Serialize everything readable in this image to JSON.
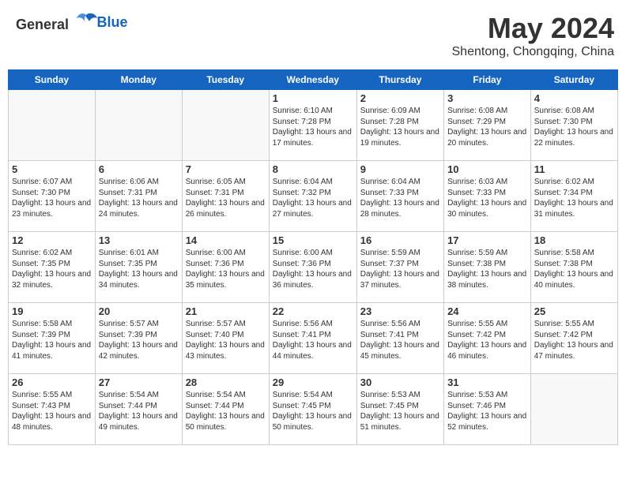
{
  "header": {
    "logo_general": "General",
    "logo_blue": "Blue",
    "month": "May 2024",
    "location": "Shentong, Chongqing, China"
  },
  "weekdays": [
    "Sunday",
    "Monday",
    "Tuesday",
    "Wednesday",
    "Thursday",
    "Friday",
    "Saturday"
  ],
  "weeks": [
    [
      {
        "day": "",
        "empty": true
      },
      {
        "day": "",
        "empty": true
      },
      {
        "day": "",
        "empty": true
      },
      {
        "day": "1",
        "sunrise": "Sunrise: 6:10 AM",
        "sunset": "Sunset: 7:28 PM",
        "daylight": "Daylight: 13 hours and 17 minutes."
      },
      {
        "day": "2",
        "sunrise": "Sunrise: 6:09 AM",
        "sunset": "Sunset: 7:28 PM",
        "daylight": "Daylight: 13 hours and 19 minutes."
      },
      {
        "day": "3",
        "sunrise": "Sunrise: 6:08 AM",
        "sunset": "Sunset: 7:29 PM",
        "daylight": "Daylight: 13 hours and 20 minutes."
      },
      {
        "day": "4",
        "sunrise": "Sunrise: 6:08 AM",
        "sunset": "Sunset: 7:30 PM",
        "daylight": "Daylight: 13 hours and 22 minutes."
      }
    ],
    [
      {
        "day": "5",
        "sunrise": "Sunrise: 6:07 AM",
        "sunset": "Sunset: 7:30 PM",
        "daylight": "Daylight: 13 hours and 23 minutes."
      },
      {
        "day": "6",
        "sunrise": "Sunrise: 6:06 AM",
        "sunset": "Sunset: 7:31 PM",
        "daylight": "Daylight: 13 hours and 24 minutes."
      },
      {
        "day": "7",
        "sunrise": "Sunrise: 6:05 AM",
        "sunset": "Sunset: 7:31 PM",
        "daylight": "Daylight: 13 hours and 26 minutes."
      },
      {
        "day": "8",
        "sunrise": "Sunrise: 6:04 AM",
        "sunset": "Sunset: 7:32 PM",
        "daylight": "Daylight: 13 hours and 27 minutes."
      },
      {
        "day": "9",
        "sunrise": "Sunrise: 6:04 AM",
        "sunset": "Sunset: 7:33 PM",
        "daylight": "Daylight: 13 hours and 28 minutes."
      },
      {
        "day": "10",
        "sunrise": "Sunrise: 6:03 AM",
        "sunset": "Sunset: 7:33 PM",
        "daylight": "Daylight: 13 hours and 30 minutes."
      },
      {
        "day": "11",
        "sunrise": "Sunrise: 6:02 AM",
        "sunset": "Sunset: 7:34 PM",
        "daylight": "Daylight: 13 hours and 31 minutes."
      }
    ],
    [
      {
        "day": "12",
        "sunrise": "Sunrise: 6:02 AM",
        "sunset": "Sunset: 7:35 PM",
        "daylight": "Daylight: 13 hours and 32 minutes."
      },
      {
        "day": "13",
        "sunrise": "Sunrise: 6:01 AM",
        "sunset": "Sunset: 7:35 PM",
        "daylight": "Daylight: 13 hours and 34 minutes."
      },
      {
        "day": "14",
        "sunrise": "Sunrise: 6:00 AM",
        "sunset": "Sunset: 7:36 PM",
        "daylight": "Daylight: 13 hours and 35 minutes."
      },
      {
        "day": "15",
        "sunrise": "Sunrise: 6:00 AM",
        "sunset": "Sunset: 7:36 PM",
        "daylight": "Daylight: 13 hours and 36 minutes."
      },
      {
        "day": "16",
        "sunrise": "Sunrise: 5:59 AM",
        "sunset": "Sunset: 7:37 PM",
        "daylight": "Daylight: 13 hours and 37 minutes."
      },
      {
        "day": "17",
        "sunrise": "Sunrise: 5:59 AM",
        "sunset": "Sunset: 7:38 PM",
        "daylight": "Daylight: 13 hours and 38 minutes."
      },
      {
        "day": "18",
        "sunrise": "Sunrise: 5:58 AM",
        "sunset": "Sunset: 7:38 PM",
        "daylight": "Daylight: 13 hours and 40 minutes."
      }
    ],
    [
      {
        "day": "19",
        "sunrise": "Sunrise: 5:58 AM",
        "sunset": "Sunset: 7:39 PM",
        "daylight": "Daylight: 13 hours and 41 minutes."
      },
      {
        "day": "20",
        "sunrise": "Sunrise: 5:57 AM",
        "sunset": "Sunset: 7:39 PM",
        "daylight": "Daylight: 13 hours and 42 minutes."
      },
      {
        "day": "21",
        "sunrise": "Sunrise: 5:57 AM",
        "sunset": "Sunset: 7:40 PM",
        "daylight": "Daylight: 13 hours and 43 minutes."
      },
      {
        "day": "22",
        "sunrise": "Sunrise: 5:56 AM",
        "sunset": "Sunset: 7:41 PM",
        "daylight": "Daylight: 13 hours and 44 minutes."
      },
      {
        "day": "23",
        "sunrise": "Sunrise: 5:56 AM",
        "sunset": "Sunset: 7:41 PM",
        "daylight": "Daylight: 13 hours and 45 minutes."
      },
      {
        "day": "24",
        "sunrise": "Sunrise: 5:55 AM",
        "sunset": "Sunset: 7:42 PM",
        "daylight": "Daylight: 13 hours and 46 minutes."
      },
      {
        "day": "25",
        "sunrise": "Sunrise: 5:55 AM",
        "sunset": "Sunset: 7:42 PM",
        "daylight": "Daylight: 13 hours and 47 minutes."
      }
    ],
    [
      {
        "day": "26",
        "sunrise": "Sunrise: 5:55 AM",
        "sunset": "Sunset: 7:43 PM",
        "daylight": "Daylight: 13 hours and 48 minutes."
      },
      {
        "day": "27",
        "sunrise": "Sunrise: 5:54 AM",
        "sunset": "Sunset: 7:44 PM",
        "daylight": "Daylight: 13 hours and 49 minutes."
      },
      {
        "day": "28",
        "sunrise": "Sunrise: 5:54 AM",
        "sunset": "Sunset: 7:44 PM",
        "daylight": "Daylight: 13 hours and 50 minutes."
      },
      {
        "day": "29",
        "sunrise": "Sunrise: 5:54 AM",
        "sunset": "Sunset: 7:45 PM",
        "daylight": "Daylight: 13 hours and 50 minutes."
      },
      {
        "day": "30",
        "sunrise": "Sunrise: 5:53 AM",
        "sunset": "Sunset: 7:45 PM",
        "daylight": "Daylight: 13 hours and 51 minutes."
      },
      {
        "day": "31",
        "sunrise": "Sunrise: 5:53 AM",
        "sunset": "Sunset: 7:46 PM",
        "daylight": "Daylight: 13 hours and 52 minutes."
      },
      {
        "day": "",
        "empty": true
      }
    ]
  ]
}
